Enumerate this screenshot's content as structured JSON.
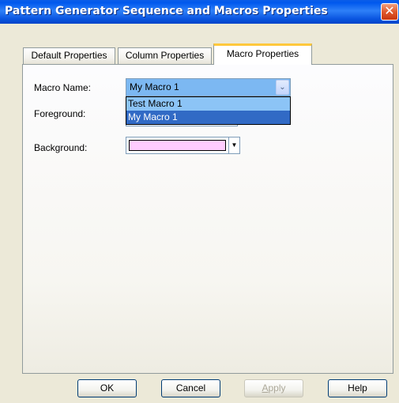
{
  "window": {
    "title": "Pattern Generator Sequence and Macros Properties",
    "close_glyph": "✕",
    "close_icon": "close-icon"
  },
  "tabs": [
    {
      "label": "Default Properties",
      "selected": false
    },
    {
      "label": "Column Properties",
      "selected": false
    },
    {
      "label": "Macro Properties",
      "selected": true
    }
  ],
  "form": {
    "macro_name_label": "Macro Name:",
    "macro_name_value": "My Macro 1",
    "macro_name_options": [
      "Test Macro 1",
      "My Macro 1"
    ],
    "dropdown_arrow_glyph": "⌄",
    "foreground_label": "Foreground:",
    "background_label": "Background:",
    "background_color": "#FFCCFF",
    "picker_arrow_glyph": "▼"
  },
  "buttons": {
    "ok": "OK",
    "cancel": "Cancel",
    "apply_first": "A",
    "apply_rest": "pply",
    "help": "Help",
    "apply_enabled": false
  },
  "colors": {
    "titlebar": "#0058EE",
    "dropdown_selected": "#316AC5",
    "dropdown_hover": "#8CC4F6",
    "tab_highlight": "#FFC83C",
    "face": "#ECE9D8"
  }
}
